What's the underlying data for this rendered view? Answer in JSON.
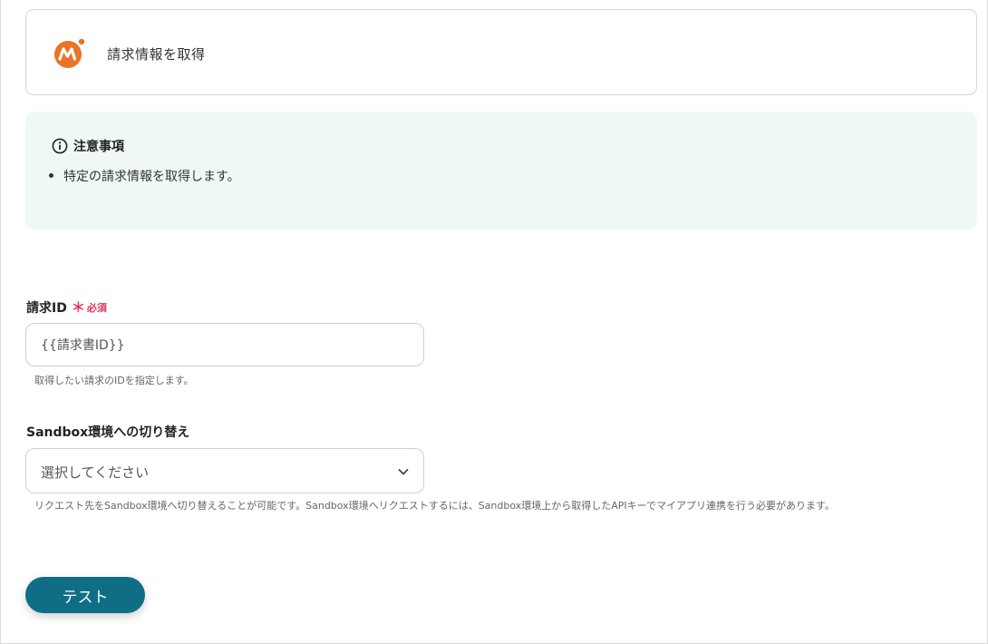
{
  "app": {
    "title": "請求情報を取得",
    "logo_icon": "money-forward-logo-icon",
    "logo_color": "#e8742a"
  },
  "notice": {
    "icon": "info-circle-icon",
    "title": "注意事項",
    "items": [
      "特定の請求情報を取得します。"
    ]
  },
  "fields": {
    "invoice_id": {
      "label": "請求ID",
      "required_mark": "＊",
      "required_text": "必須",
      "value": "{{請求書ID}}",
      "help": "取得したい請求のIDを指定します。"
    },
    "sandbox": {
      "label": "Sandbox環境への切り替え",
      "selected": "選択してください",
      "help": "リクエスト先をSandbox環境へ切り替えることが可能です。Sandbox環境へリクエストするには、Sandbox環境上から取得したAPIキーでマイアプリ連携を行う必要があります。"
    }
  },
  "actions": {
    "test_label": "テスト"
  },
  "colors": {
    "accent": "#0f6e86",
    "required": "#e5345c",
    "notice_bg": "#eff8f7"
  }
}
